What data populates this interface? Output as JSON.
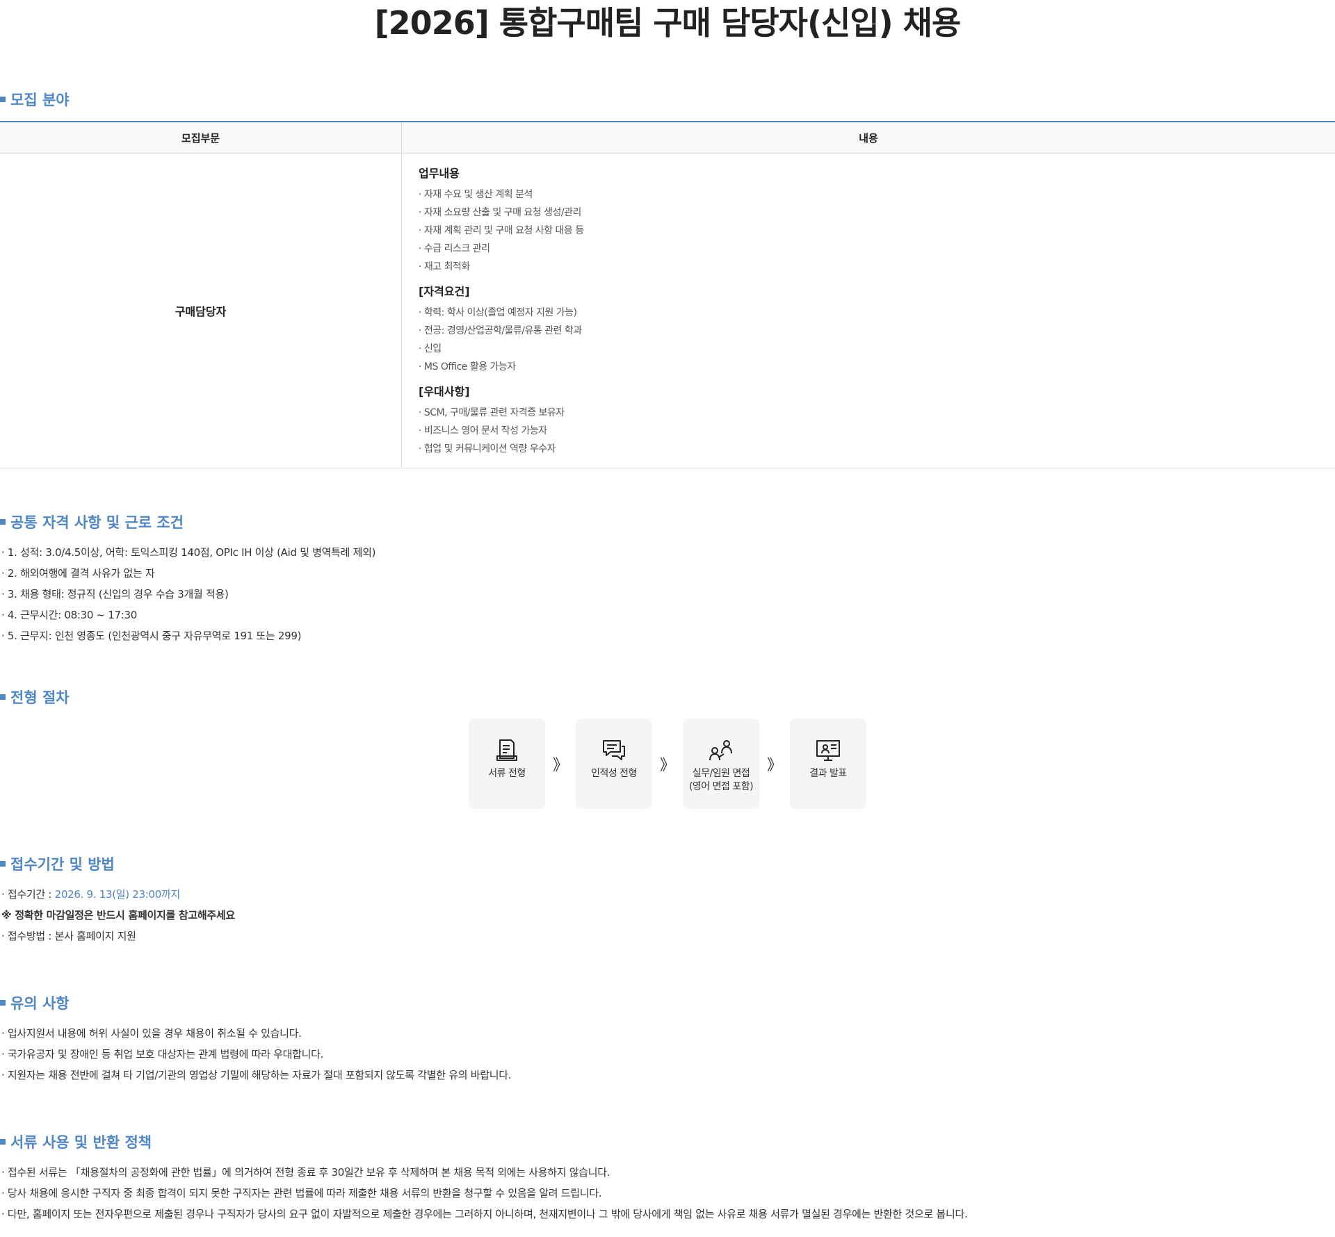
{
  "page": {
    "title": "[2026] 통합구매팀 구매 담당자(신입) 채용"
  },
  "recruit": {
    "section_title": "모집 분야",
    "headers": [
      "모집부문",
      "내용"
    ],
    "department": "구매담당자",
    "groups": [
      {
        "title": "업무내용",
        "items": [
          "· 자재 수요 및 생산 계획 분석",
          "· 자재 소요량 산출 및 구매 요청 생성/관리",
          "· 자재 계획 관리 및 구매 요청 사항 대응 등",
          "· 수급 리스크 관리",
          "· 재고 최적화"
        ]
      },
      {
        "title": "[자격요건]",
        "items": [
          "· 학력: 학사 이상(졸업 예정자 지원 가능)",
          "· 전공: 경영/산업공학/물류/유통 관련 학과",
          "· 신입",
          "· MS Office 활용 가능자"
        ]
      },
      {
        "title": "[우대사항]",
        "items": [
          "· SCM, 구매/물류 관련 자격증 보유자",
          "· 비즈니스 영어 문서 작성 가능자",
          "· 협업 및 커뮤니케이션 역량 우수자"
        ]
      }
    ]
  },
  "common": {
    "section_title": "공통 자격 사항 및 근로 조건",
    "items": [
      "· 1. 성적: 3.0/4.5이상, 어학: 토익스피킹 140점, OPIc IH 이상 (Aid 및 병역특례 제외)",
      "· 2. 해외여행에 결격 사유가 없는 자",
      "· 3. 채용 형태: 정규직 (신입의 경우 수습 3개월 적용)",
      "· 4. 근무시간: 08:30 ~ 17:30",
      "· 5. 근무지: 인천 영종도 (인천광역시 중구 자유무역로 191 또는 299)"
    ]
  },
  "process": {
    "section_title": "전형 절차",
    "arrow": "》",
    "steps": [
      {
        "label": "서류 전형",
        "icon": "document-icon"
      },
      {
        "label": "인적성 전형",
        "icon": "chat-icon"
      },
      {
        "label": "실무/임원 면접\n(영어 면접 포함)",
        "icon": "interview-icon"
      },
      {
        "label": "결과 발표",
        "icon": "monitor-icon"
      }
    ]
  },
  "apply": {
    "section_title": "접수기간 및 방법",
    "period_label": "· 접수기간 : ",
    "period_value": "2026. 9. 13(일) 23:00까지",
    "notice": "※ 정확한 마감일정은 반드시 홈페이지를 참고해주세요",
    "method": "· 접수방법 : 본사 홈페이지 지원"
  },
  "caution": {
    "section_title": "유의 사항",
    "items": [
      "· 입사지원서 내용에 허위 사실이 있을 경우 채용이 취소될 수 있습니다.",
      "· 국가유공자 및 장애인 등 취업 보호 대상자는 관계 법령에 따라 우대합니다.",
      "· 지원자는 채용 전반에 걸쳐 타 기업/기관의 영업상 기밀에 해당하는 자료가 절대 포함되지 않도록 각별한 유의 바랍니다."
    ]
  },
  "policy": {
    "section_title": "서류 사용 및 반환 정책",
    "items": [
      "· 접수된 서류는 「채용절차의 공정화에 관한 법률」에 의거하여 전형 종료 후 30일간 보유 후 삭제하며 본 채용 목적 외에는 사용하지 않습니다.",
      "· 당사 채용에 응시한 구직자 중 최종 합격이 되지 못한 구직자는 관련 법률에 따라 제출한 채용 서류의 반환을 청구할 수 있음을 알려 드립니다.",
      "· 다만, 홈페이지 또는 전자우편으로 제출된 경우나 구직자가 당사의 요구 없이 자발적으로 제출한 경우에는 그러하지 아니하며, 천재지변이나 그 밖에 당사에게 책임 없는 사유로 채용 서류가 멸실된 경우에는 반환한 것으로 봅니다."
    ]
  },
  "colors": {
    "accent": "#4f86c6",
    "text": "#333333",
    "step_bg": "#f5f5f5"
  }
}
